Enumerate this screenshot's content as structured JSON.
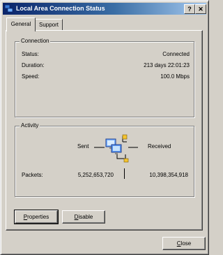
{
  "window": {
    "title": "Local Area Connection Status",
    "help_label": "?",
    "close_glyph": "✕"
  },
  "tabs": [
    {
      "label": "General"
    },
    {
      "label": "Support"
    }
  ],
  "connection": {
    "legend": "Connection",
    "rows": [
      {
        "label": "Status:",
        "value": "Connected"
      },
      {
        "label": "Duration:",
        "value": "213 days 22:01:23"
      },
      {
        "label": "Speed:",
        "value": "100.0 Mbps"
      }
    ]
  },
  "activity": {
    "legend": "Activity",
    "sent_label": "Sent",
    "received_label": "Received",
    "packets_label": "Packets:",
    "packets_sent": "5,252,653,720",
    "packets_received": "10,398,354,918",
    "icon": "network-computers-icon"
  },
  "buttons": {
    "properties_first": "P",
    "properties_rest": "roperties",
    "disable_first": "D",
    "disable_rest": "isable",
    "close_first": "C",
    "close_rest": "lose"
  },
  "colors": {
    "title_start": "#0a246a",
    "title_end": "#a6caf0",
    "face": "#d4d0c8"
  }
}
